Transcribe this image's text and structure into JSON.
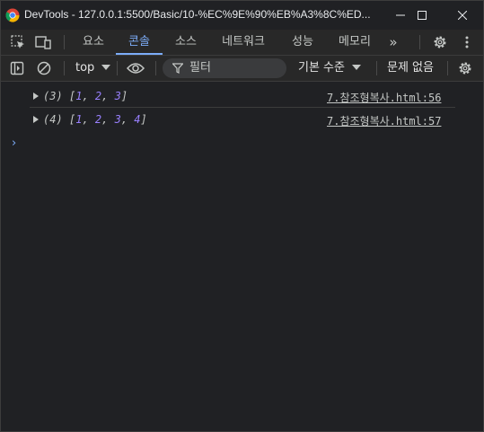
{
  "window": {
    "title": "DevTools - 127.0.0.1:5500/Basic/10-%EC%9E%90%EB%A3%8C%ED...",
    "icons": {
      "app": "chrome-icon",
      "minimize": "minimize-icon",
      "maximize": "maximize-icon",
      "close": "close-icon"
    }
  },
  "tabbar": {
    "icons": [
      "inspect-element-icon",
      "device-toolbar-icon",
      "settings-icon",
      "more-options-icon"
    ],
    "tabs": [
      {
        "label": "요소",
        "active": false
      },
      {
        "label": "콘솔",
        "active": true
      },
      {
        "label": "소스",
        "active": false
      },
      {
        "label": "네트워크",
        "active": false
      },
      {
        "label": "성능",
        "active": false
      },
      {
        "label": "메모리",
        "active": false
      }
    ],
    "more_tabs": "»",
    "accent": "#7cacf8"
  },
  "console_toolbar": {
    "context": "top",
    "filter_placeholder": "필터",
    "levels": "기본 수준",
    "issues": "문제 없음",
    "icons": [
      "sidebar-toggle-icon",
      "clear-console-icon",
      "chevron-down-icon",
      "eye-icon",
      "filter-icon",
      "settings-icon"
    ]
  },
  "messages": [
    {
      "count": "(3)",
      "values": [
        "1",
        "2",
        "3"
      ],
      "source": "7.참조형복사.html:56"
    },
    {
      "count": "(4)",
      "values": [
        "1",
        "2",
        "3",
        "4"
      ],
      "source": "7.참조형복사.html:57"
    }
  ],
  "prompt": "›",
  "colors": {
    "background": "#202124",
    "number": "#9980ff",
    "link": "#7cacf8"
  }
}
